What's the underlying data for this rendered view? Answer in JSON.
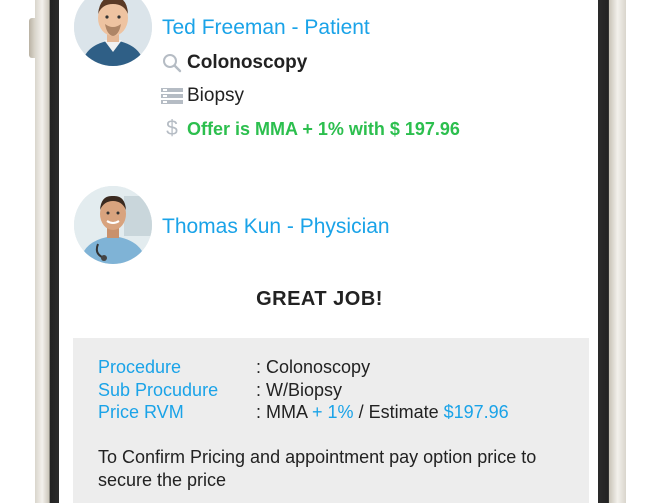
{
  "patient": {
    "name": "Ted Freeman - Patient",
    "procedure": "Colonoscopy",
    "sub_procedure": "Biopsy",
    "offer": "Offer is MMA + 1% with $ 197.96"
  },
  "physician": {
    "name": "Thomas Kun - Physician"
  },
  "message": "GREAT JOB!",
  "summary": {
    "procedure_label": "Procedure",
    "procedure_value": ": Colonoscopy",
    "sub_label": "Sub Procudure",
    "sub_value": ": W/Biopsy",
    "price_label": "Price RVM",
    "price_prefix": ": MMA",
    "price_plus": "+ 1%",
    "price_mid": "/ Estimate",
    "price_amount": "$197.96",
    "confirm_text": "To Confirm Pricing and appointment pay option price to secure the price"
  },
  "icons": {
    "procedure": "search-icon",
    "sub_procedure": "list-icon",
    "offer": "dollar-icon"
  },
  "colors": {
    "accent": "#1aa3e8",
    "offer_green": "#2cbf4e",
    "summary_bg": "#ededed"
  }
}
